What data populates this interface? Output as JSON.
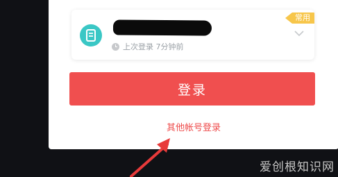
{
  "account": {
    "badge": "常用",
    "name": "",
    "last_login": "上次登录 7分钟前",
    "avatar_icon": "contact-book-icon",
    "avatar_color": "#3ac7c5",
    "badge_color": "#f7c64b"
  },
  "actions": {
    "login_label": "登录",
    "other_account_label": "其他帐号登录",
    "login_color": "#f04f4f"
  },
  "watermark": {
    "text": "爱创根知识网"
  }
}
